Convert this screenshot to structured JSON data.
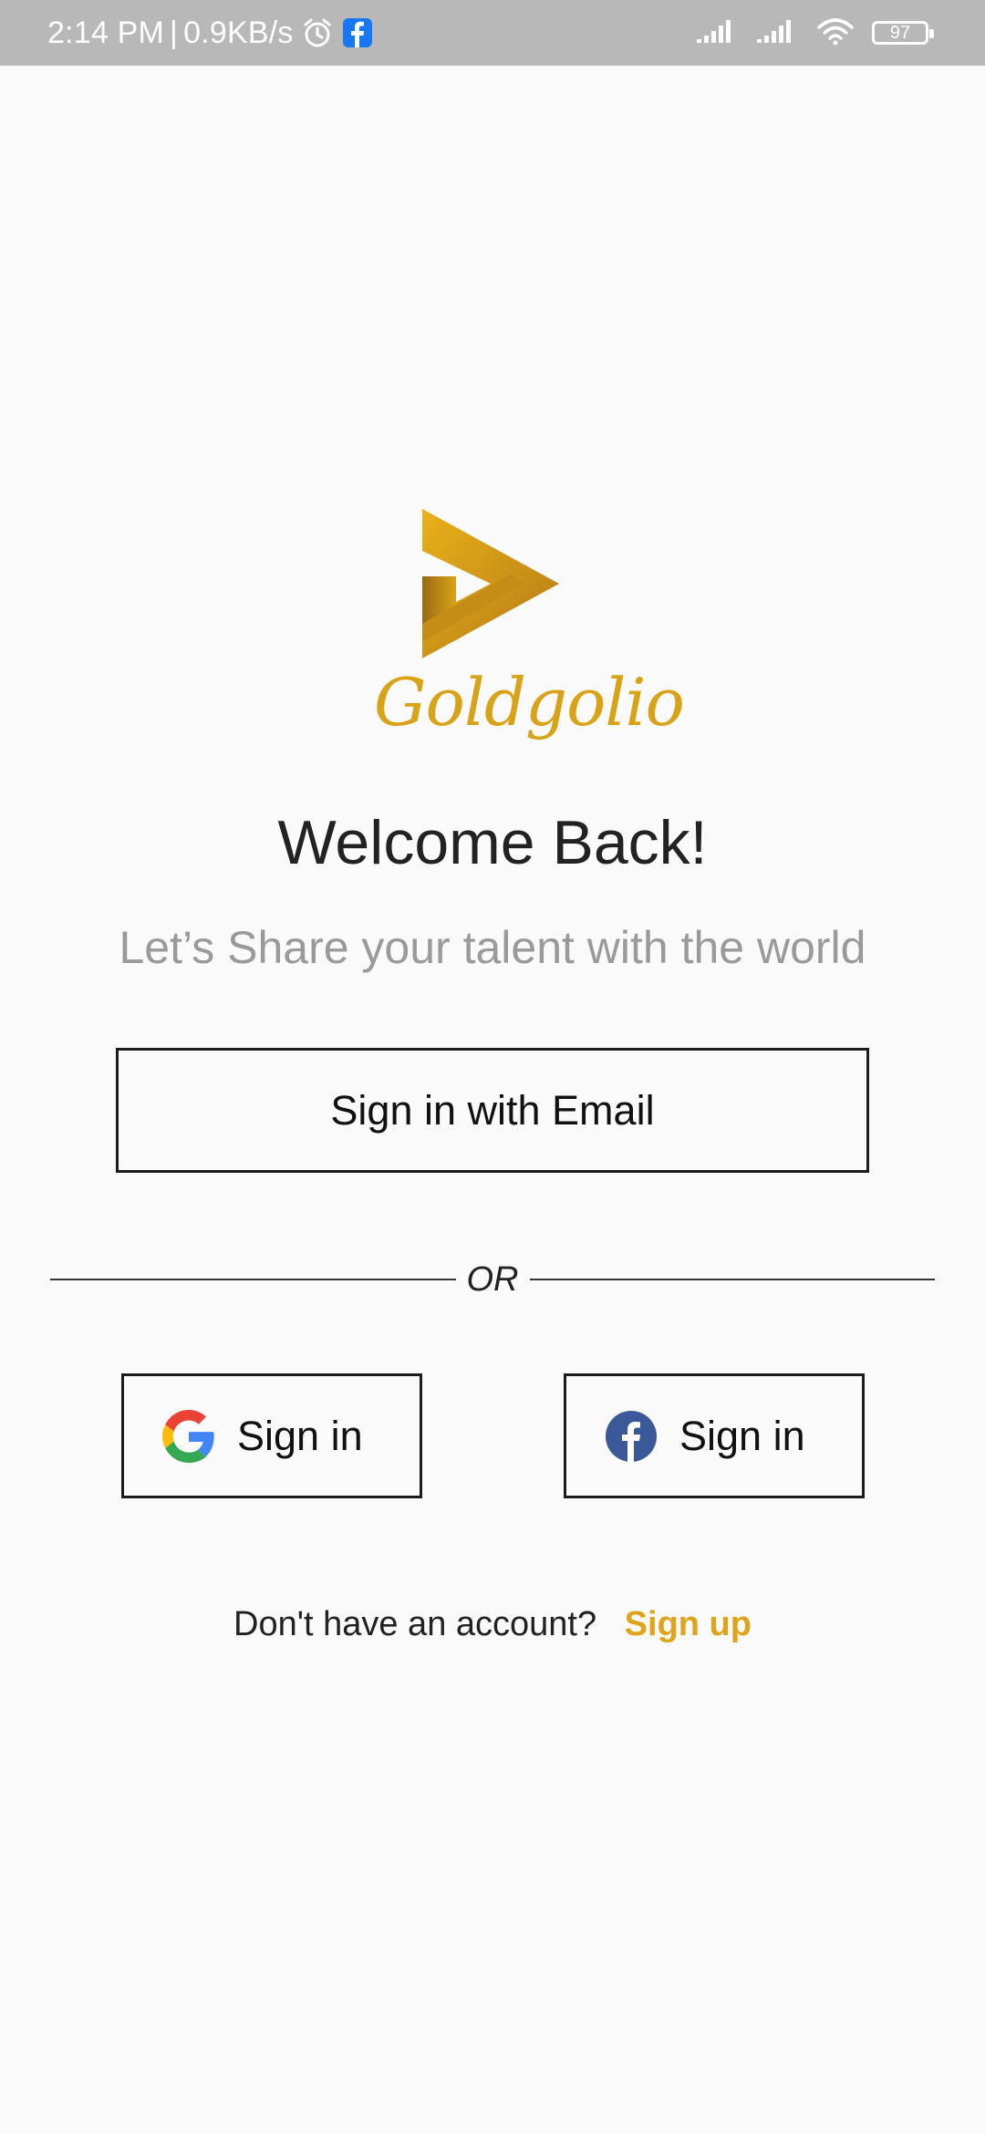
{
  "status_bar": {
    "time": "2:14 PM",
    "separator": "|",
    "network_speed": "0.9KB/s",
    "battery_level": "97",
    "icons": [
      "alarm-icon",
      "facebook-notification-icon",
      "signal-icon",
      "signal-icon",
      "wifi-icon",
      "battery-icon"
    ]
  },
  "brand": {
    "name": "Goldgolio",
    "logo_icon": "play-triangle-logo",
    "color": "#d9a318"
  },
  "welcome": {
    "title": "Welcome Back!",
    "subtitle": "Let’s Share your talent with the world"
  },
  "buttons": {
    "email_label": "Sign in with Email",
    "divider_label": "OR",
    "google_label": "Sign in",
    "google_icon": "google-icon",
    "facebook_label": "Sign in",
    "facebook_icon": "facebook-icon"
  },
  "signup": {
    "prompt": "Don't have an account?",
    "link_label": "Sign up",
    "link_color": "#e0a41a"
  }
}
